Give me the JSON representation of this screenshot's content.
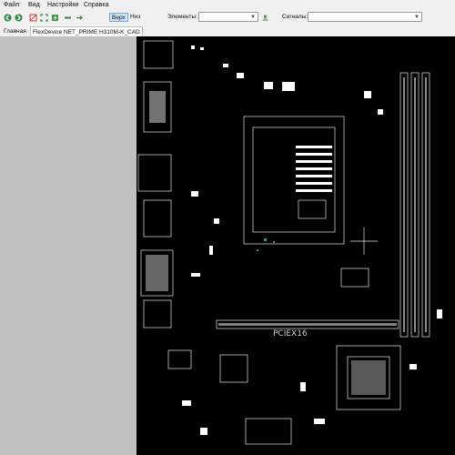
{
  "menu": {
    "items": [
      {
        "label": "Файл"
      },
      {
        "label": "Вид"
      },
      {
        "label": "Настройки"
      },
      {
        "label": "Справка"
      }
    ]
  },
  "toolbar": {
    "view_top_label": "Верх",
    "view_bottom_label": "Низ",
    "elements_label": "Элементы:",
    "elements_value": "",
    "signals_label": "Сигналы:",
    "signals_value": ""
  },
  "tabs": [
    {
      "label": "Главная",
      "active": false
    },
    {
      "label": "FlexDevice NET_PRIME H310M-K_CAD",
      "active": true
    }
  ],
  "board": {
    "center_silkscreen": "PCIEX16",
    "colors": {
      "background": "#000000",
      "outline": "#e6e6e6",
      "pad": "#ffffff",
      "accent": "#2a9d8f"
    }
  },
  "icons": [
    "back-icon",
    "forward-icon",
    "flip-icon",
    "fit-icon",
    "zoom-in-icon",
    "zoom-out-icon",
    "minus-icon",
    "arrow-icon",
    "search-icon"
  ]
}
